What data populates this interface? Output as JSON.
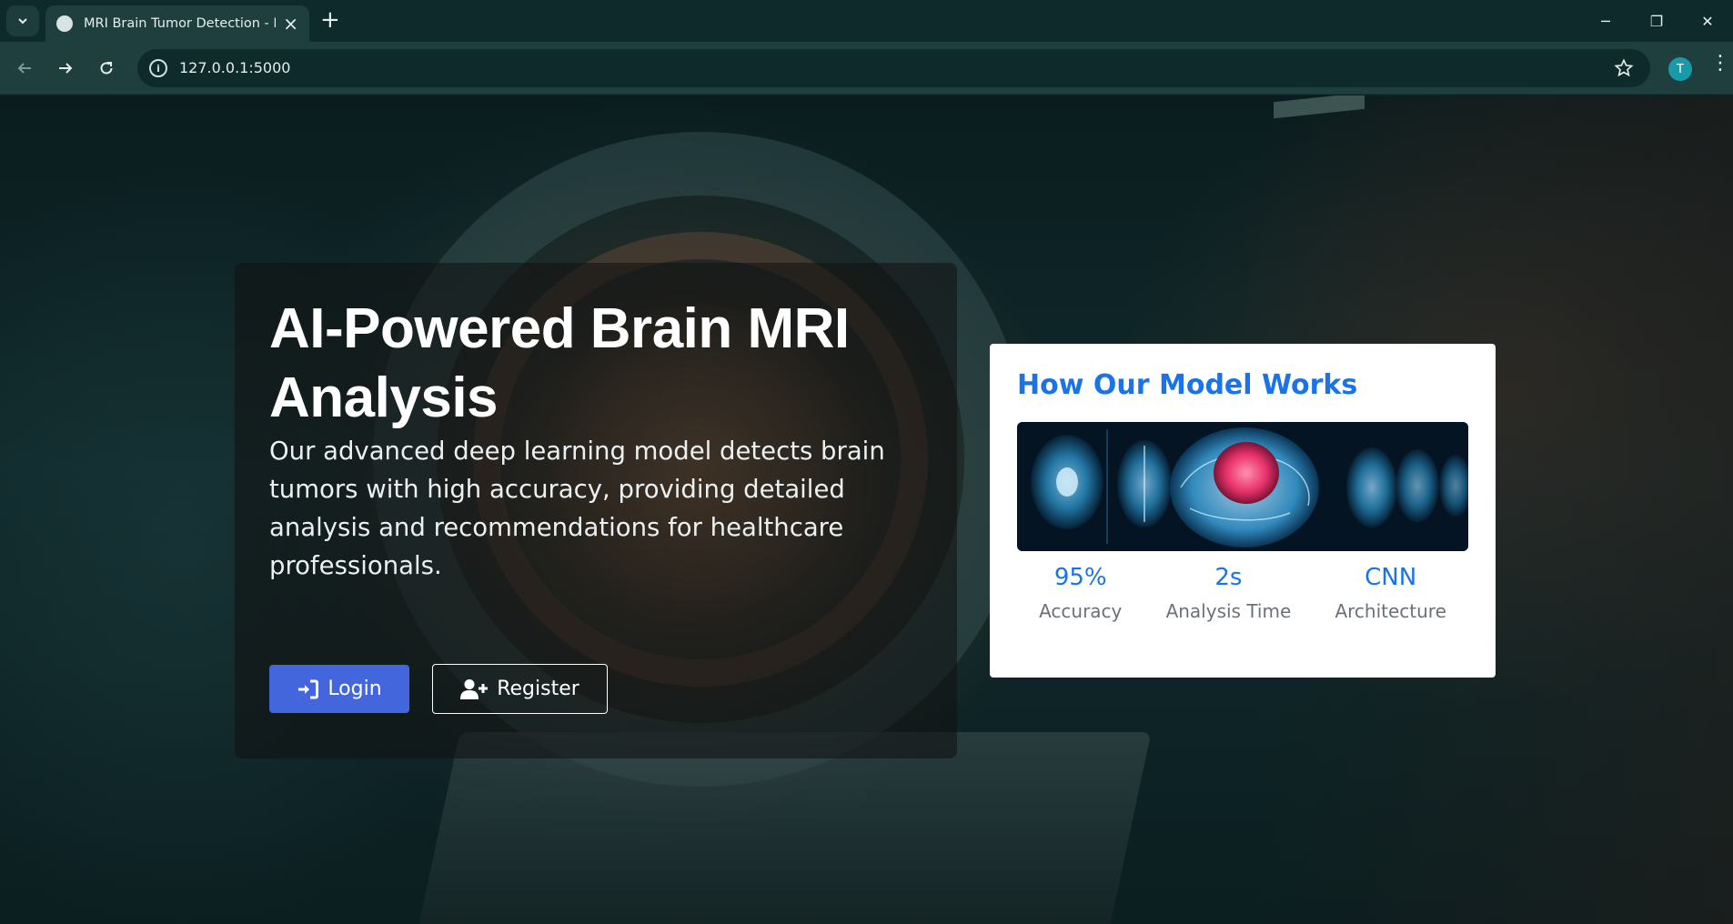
{
  "browser": {
    "tab_title": "MRI Brain Tumor Detection - Ho",
    "new_tab_symbol": "+",
    "url": "127.0.0.1:5000",
    "profile_initial": "T",
    "window_controls": {
      "minimize": "─",
      "restore": "❐",
      "close": "✕"
    }
  },
  "hero": {
    "title": "AI-Powered Brain MRI Analysis",
    "description": "Our advanced deep learning model detects brain tumors with high accuracy, providing detailed analysis and recommendations for healthcare professionals.",
    "login_label": "Login",
    "register_label": "Register"
  },
  "model_card": {
    "title": "How Our Model Works",
    "stats": [
      {
        "value": "95%",
        "label": "Accuracy"
      },
      {
        "value": "2s",
        "label": "Analysis Time"
      },
      {
        "value": "CNN",
        "label": "Architecture"
      }
    ]
  },
  "colors": {
    "accent": "#1a73e8",
    "login_button": "#4466dd",
    "browser_frame": "#0f2a2a"
  }
}
